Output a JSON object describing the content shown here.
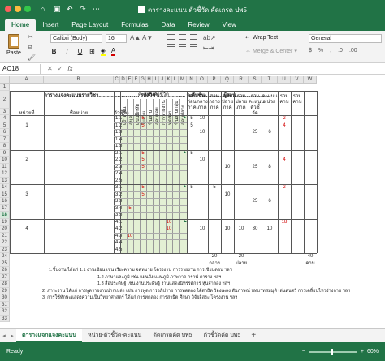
{
  "window": {
    "title": "ตารางคะแนน ตัวชี้วัด คัดเกรด ปพ5"
  },
  "ribbon_tabs": [
    "Home",
    "Insert",
    "Page Layout",
    "Formulas",
    "Data",
    "Review",
    "View"
  ],
  "ribbon": {
    "paste_label": "Paste",
    "font_name": "Calibri (Body)",
    "font_size": "16",
    "wrap_text": "Wrap Text",
    "merge_center": "Merge & Center",
    "number_format": "General"
  },
  "formula_bar": {
    "name_box": "AC18",
    "fx": "fx",
    "formula": ""
  },
  "columns": [
    "A",
    "B",
    "C",
    "D",
    "E",
    "F",
    "G",
    "H",
    "I",
    "J",
    "K",
    "L",
    "M",
    "N",
    "O",
    "P",
    "Q",
    "R",
    "S",
    "T",
    "U",
    "V",
    "W"
  ],
  "rows": [
    "1",
    "2",
    "3",
    "4",
    "5",
    "6",
    "7",
    "8",
    "9",
    "10",
    "11",
    "12",
    "13",
    "14",
    "15",
    "16",
    "17",
    "18",
    "19",
    "20",
    "21",
    "22",
    "23",
    "24",
    "25",
    "26",
    "27",
    "28",
    "29",
    "30",
    "31",
    "32",
    "33"
  ],
  "selected_row": "18",
  "sheet": {
    "title_line": "ตารางแจงคะแนนรายวิชา.............................. รหัสวิชา.................... ระดับชั้น............. ผู้สอน..........................",
    "headers": {
      "unit": "หน่วยที่",
      "unit_name": "ชื่อหน่วย",
      "indicator": "ตัวชี้วัด",
      "score_group": "คะแนนตัวชี้วัด",
      "sub_cols": [
        "เข้าเรียน",
        "สมุด",
        "แบบฝึกหัด",
        "ใบงาน",
        "ชิ้นงาน",
        "สอบย่อย",
        "การรายงาน",
        "ทดสอบ",
        "ชิ้นงานกลุ่ม",
        "สอบปลาย"
      ],
      "sum_cols": [
        "สอบ ก่อน ภาค",
        "รวม กลาง ภาค",
        "สอบ กลาง ภาค",
        "สอบ ปลาย ภาค",
        "รวม ปลาย ภาค",
        "รวม คะแนน ตัวชี้วัด",
        "คะแนน หน่วย",
        "รวม คาบ",
        "รวม คาบ"
      ]
    },
    "units": [
      {
        "no": "1",
        "indicators": [
          "1.1",
          "1.2",
          "1.3",
          "1.4",
          "1.5"
        ]
      },
      {
        "no": "2",
        "indicators": [
          "2.1",
          "2.2",
          "2.3",
          "2.4",
          "2.5"
        ]
      },
      {
        "no": "3",
        "indicators": [
          "3.1",
          "3.2",
          "3.3",
          "3.4",
          "3.5"
        ]
      },
      {
        "no": "4",
        "indicators": [
          "4.1",
          "4.2",
          "4.3",
          "4.4",
          "4.5"
        ]
      }
    ],
    "red_values": [
      "5",
      "5",
      "5",
      "5",
      "5",
      "5",
      "5",
      "5",
      "10",
      "10",
      "10"
    ],
    "sum_values": {
      "u1": [
        "5",
        "5",
        "10",
        "10",
        "25",
        "6",
        "2",
        "4"
      ],
      "u2": [
        "5",
        "10",
        "10",
        "25",
        "8",
        "4"
      ],
      "u3": [
        "5",
        "5",
        "10",
        "25",
        "6",
        "2"
      ],
      "u4": [
        "10",
        "10",
        "10",
        "30",
        "10",
        "18"
      ]
    },
    "totals": [
      "20",
      "20",
      "40"
    ],
    "totals_labels": [
      "กลาง",
      "ปลาย",
      "คาบ"
    ],
    "notes": [
      "1.ชิ้นงาน ได้แก่ 1.1 งานเขียน เช่น เรียงความ จดหมาย โครงงาน การรายงาน การเขียนตอบ ฯลฯ",
      "1.2 ภาษาและภูมิ เช่น แผนผัง แผนภูมิ ภาพวาด กราฟ ตาราง ฯลฯ",
      "1.3 สื่อประดิษฐ์ เช่น งานประดิษฐ์ งานแสดงนิทรรศการ หุ่นจำลอง ฯลฯ",
      "2. ภาระงาน ได้แก่ การพูดรายงานปากเปล่า เช่น การพูด การอภิปราย การทดลอง ได้สาธิต ร้องเพลง สัมภาษณ์ บทบาทสมมุติ เล่นดนตรี การเคลื่อนไหวร่างกาย ฯลฯ",
      "3. การใช้ทักษะแสดงความเป็นวิทยาศาสตร์ ได้แก่ การทดลอง การสาธิต ศึกษา วิจัยอิสระ โครงงาน ฯลฯ"
    ]
  },
  "sheet_tabs": [
    "ตารางแจกแจงคะแนน",
    "หน่วย-ตัวชี้วัด-คะแนน",
    "ตัดเกรดคัด ปพ5",
    "ตัวชี้วัดคัด ปพ5"
  ],
  "active_sheet": "ตารางแจกแจงคะแนน",
  "status": {
    "ready": "Ready",
    "zoom": "60%"
  },
  "colors": {
    "brand": "#217346",
    "highlight_green": "#e3f0d4",
    "red": "#d20000"
  }
}
